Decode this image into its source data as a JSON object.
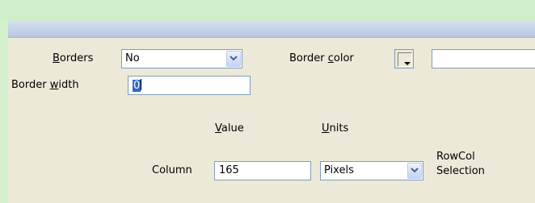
{
  "borders": {
    "label_pre": "",
    "label_key": "B",
    "label_post": "orders",
    "value": "No"
  },
  "border_color": {
    "label_pre": "Border ",
    "label_key": "c",
    "label_post": "olor",
    "value": ""
  },
  "border_width": {
    "label_pre": "Border ",
    "label_key": "w",
    "label_post": "idth",
    "value": "0"
  },
  "value_header": {
    "label_pre": "",
    "label_key": "V",
    "label_post": "alue"
  },
  "units_header": {
    "label_pre": "",
    "label_key": "U",
    "label_post": "nits"
  },
  "column": {
    "label": "Column",
    "value": "165",
    "units": "Pixels"
  },
  "rowcol": {
    "line1": "RowCol",
    "line2": "Selection"
  },
  "colors": {
    "page_bg": "#d4f0cf",
    "dialog_bg": "#ece9d8",
    "input_border": "#7f9db9",
    "selection": "#316ac5"
  },
  "icons": {
    "dropdown": "chevron-down-icon",
    "color_picker": "color-swatch-icon"
  }
}
